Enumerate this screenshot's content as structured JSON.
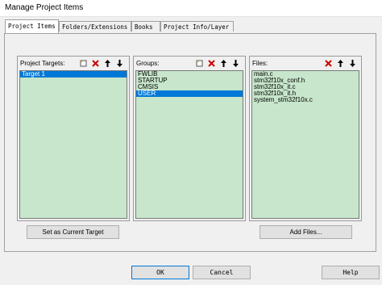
{
  "window": {
    "title": "Manage Project Items"
  },
  "tabs": [
    {
      "label": "Project Items"
    },
    {
      "label": "Folders/Extensions"
    },
    {
      "label": "Books"
    },
    {
      "label": "Project Info/Layer"
    }
  ],
  "targets": {
    "label": "Project Targets:",
    "items": [
      "Target 1"
    ],
    "selected": 0
  },
  "groups": {
    "label": "Groups:",
    "items": [
      "FWLIB",
      "STARTUP",
      "CMSIS",
      "USER"
    ],
    "selected": 3
  },
  "files": {
    "label": "Files:",
    "items": [
      "main.c",
      "stm32f10x_conf.h",
      "stm32f10x_it.c",
      "stm32f10x_it.h",
      "system_stm32f10x.c"
    ]
  },
  "buttons": {
    "set_current_target": "Set as Current Target",
    "add_files": "Add Files...",
    "ok": "OK",
    "cancel": "Cancel",
    "help": "Help"
  },
  "colors": {
    "list_bg": "#c7e6cb",
    "selection": "#0078d7",
    "delete_red": "#cc0000"
  },
  "icons": [
    "new-icon",
    "delete-icon",
    "move-up-icon",
    "move-down-icon"
  ]
}
